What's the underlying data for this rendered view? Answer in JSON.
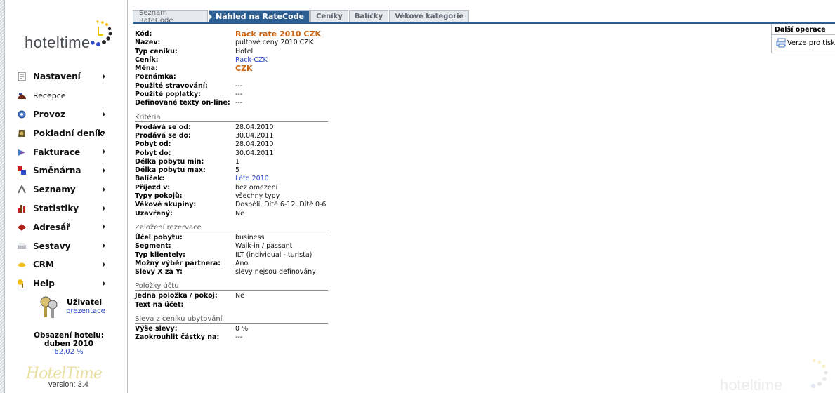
{
  "brand": {
    "logo_text": "hoteltime",
    "version": "version: 3.4",
    "bottom_logo_text": "HotelTime"
  },
  "menu": [
    {
      "label": "Nastavení",
      "icon": "settings-icon",
      "arrow": true
    },
    {
      "label": "Recepce",
      "icon": "reception-icon",
      "arrow": false
    },
    {
      "label": "Provoz",
      "icon": "operations-icon",
      "arrow": true
    },
    {
      "label": "Pokladní deník",
      "icon": "cashbook-icon",
      "arrow": true
    },
    {
      "label": "Fakturace",
      "icon": "invoice-icon",
      "arrow": true
    },
    {
      "label": "Směnárna",
      "icon": "exchange-icon",
      "arrow": true
    },
    {
      "label": "Seznamy",
      "icon": "lists-icon",
      "arrow": true
    },
    {
      "label": "Statistiky",
      "icon": "statistics-icon",
      "arrow": true
    },
    {
      "label": "Adresář",
      "icon": "address-book-icon",
      "arrow": true
    },
    {
      "label": "Sestavy",
      "icon": "reports-icon",
      "arrow": true
    },
    {
      "label": "CRM",
      "icon": "crm-icon",
      "arrow": true
    },
    {
      "label": "Help",
      "icon": "help-icon",
      "arrow": true
    }
  ],
  "user": {
    "name": "Uživatel",
    "link": "prezentace"
  },
  "occupancy": {
    "label": "Obsazení hotelu:",
    "period": "duben 2010",
    "value": "62,02 %"
  },
  "tabs": [
    "Seznam RateCode",
    "Náhled na RateCode",
    "Ceníky",
    "Balíčky",
    "Věkové kategorie"
  ],
  "active_tab": "Náhled na RateCode",
  "details": {
    "code": {
      "k": "Kód:",
      "v": "Rack rate 2010 CZK"
    },
    "name": {
      "k": "Název:",
      "v": "pultové ceny 2010 CZK"
    },
    "type": {
      "k": "Typ ceníku:",
      "v": "Hotel"
    },
    "pricelist": {
      "k": "Ceník:",
      "v": "Rack-CZK"
    },
    "currency": {
      "k": "Měna:",
      "v": "CZK"
    },
    "note": {
      "k": "Poznámka:",
      "v": ""
    },
    "meals": {
      "k": "Použité stravování:",
      "v": "---"
    },
    "fees": {
      "k": "Použité poplatky:",
      "v": "---"
    },
    "texts": {
      "k": "Definované texty on-line:",
      "v": "---"
    }
  },
  "sections": {
    "criteria": "Kritéria",
    "reservation": "Založení rezervace",
    "account_items": "Položky účtu",
    "discount": "Sleva z ceníku ubytování"
  },
  "criteria": [
    {
      "k": "Prodává se od:",
      "v": "28.04.2010"
    },
    {
      "k": "Prodává se do:",
      "v": "30.04.2011"
    },
    {
      "k": "Pobyt od:",
      "v": "28.04.2010"
    },
    {
      "k": "Pobyt do:",
      "v": "30.04.2011"
    },
    {
      "k": "Délka pobytu min:",
      "v": "1"
    },
    {
      "k": "Délka pobytu max:",
      "v": "5"
    },
    {
      "k": "Balíček:",
      "v": "Léto 2010"
    },
    {
      "k": "Příjezd v:",
      "v": "bez omezení"
    },
    {
      "k": "Typy pokojů:",
      "v": "všechny typy"
    },
    {
      "k": "Věkové skupiny:",
      "v": "Dospělí, Dítě 6-12, Dítě 0-6"
    },
    {
      "k": "Uzavřený:",
      "v": "Ne"
    }
  ],
  "reservation": [
    {
      "k": "Účel pobytu:",
      "v": "business"
    },
    {
      "k": "Segment:",
      "v": "Walk-in / passant"
    },
    {
      "k": "Typ klientely:",
      "v": "ILT (individual - turista)"
    },
    {
      "k": "Možný výběr partnera:",
      "v": "Ano"
    },
    {
      "k": "Slevy X za Y:",
      "v": "slevy nejsou definovány"
    }
  ],
  "account_items": [
    {
      "k": "Jedna položka / pokoj:",
      "v": "Ne"
    },
    {
      "k": "Text na účet:",
      "v": ""
    }
  ],
  "discount": [
    {
      "k": "Výše slevy:",
      "v": "0 %"
    },
    {
      "k": "Zaokrouhlit částky na:",
      "v": "---"
    }
  ],
  "panel": {
    "title": "Další operace",
    "print_label": "Verze pro tisk"
  },
  "colors": {
    "accent": "#2d5e91",
    "orange": "#c8620f",
    "link": "#2a48c9"
  }
}
